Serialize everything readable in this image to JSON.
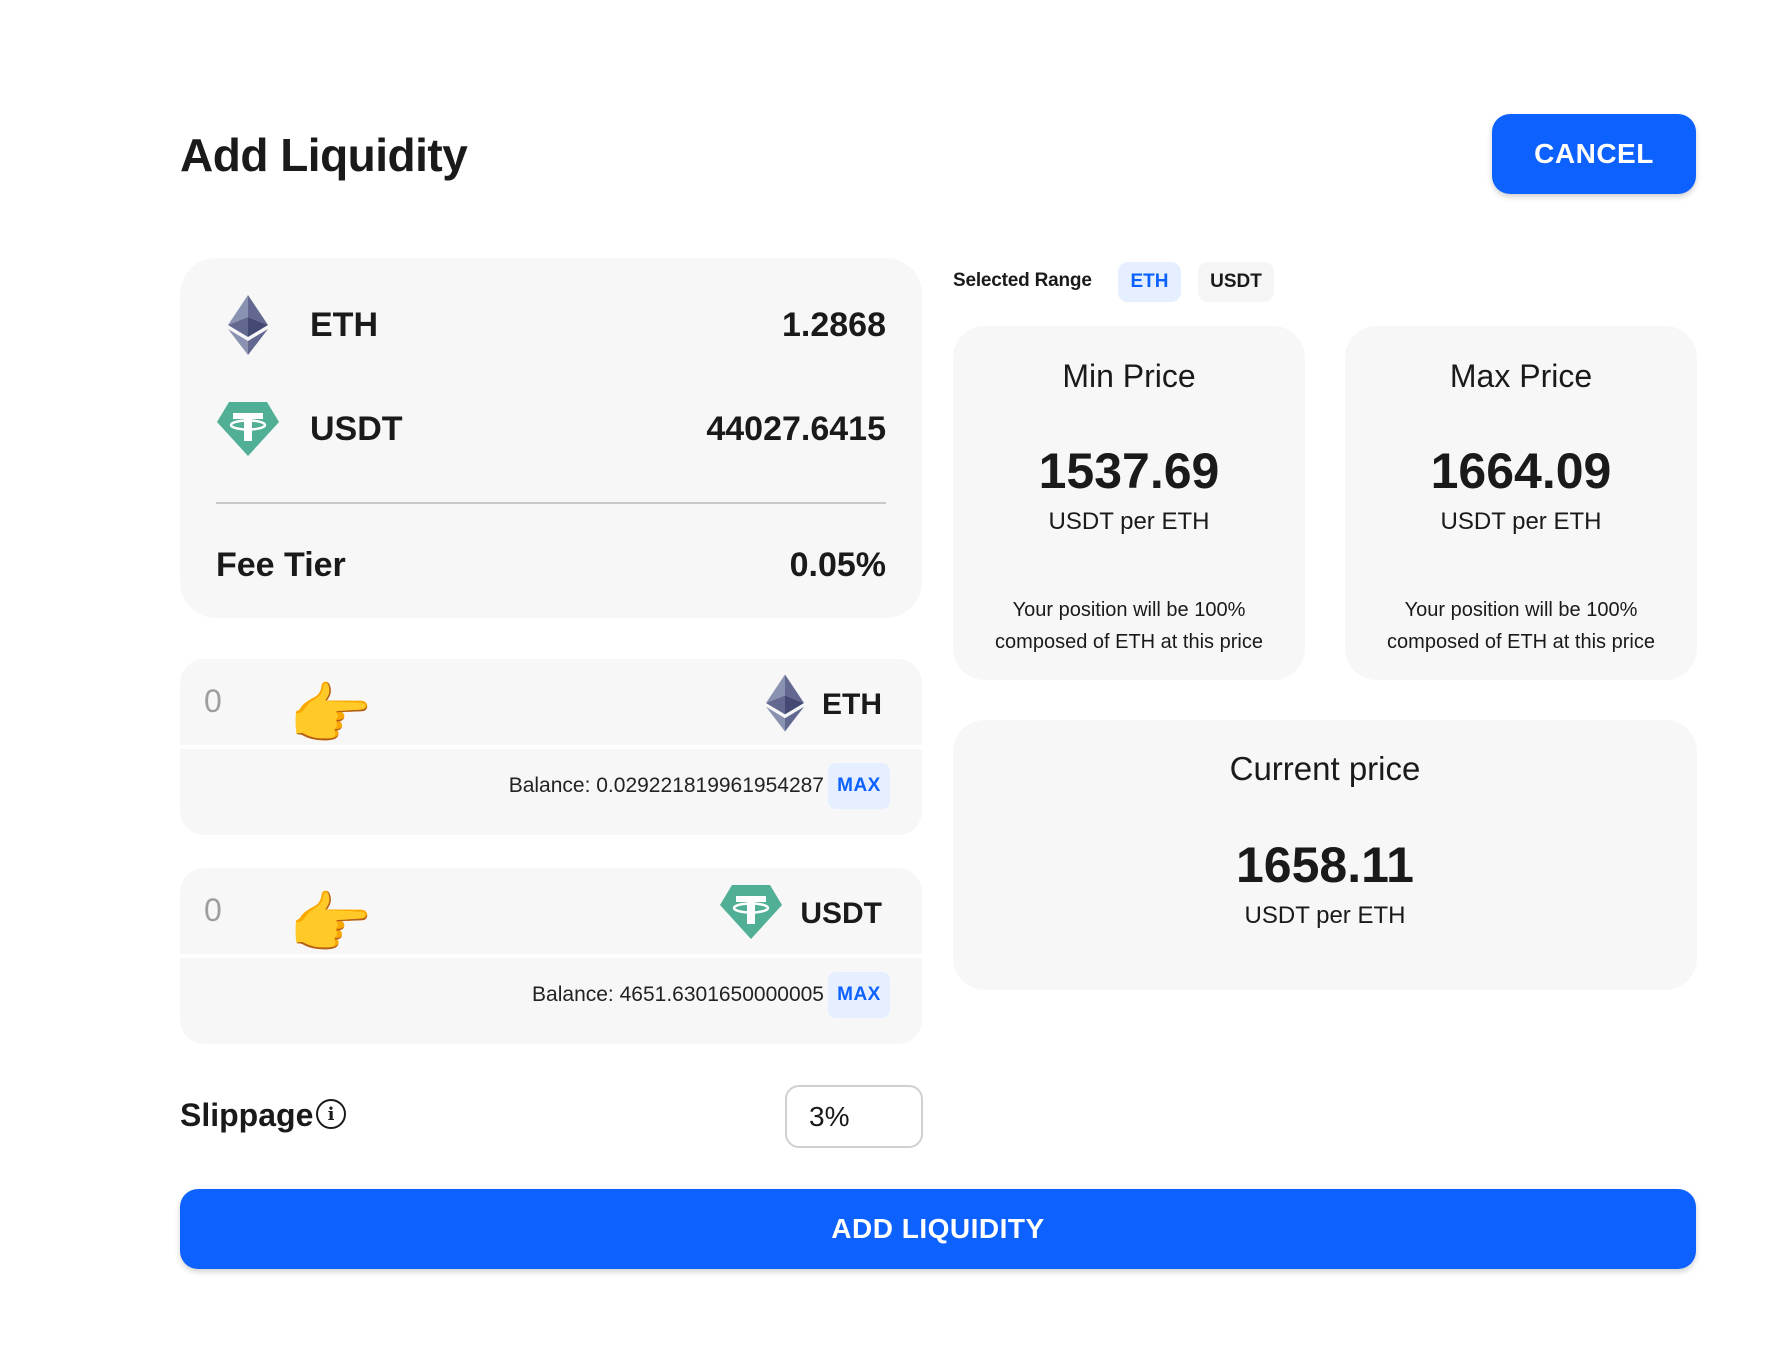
{
  "header": {
    "title": "Add Liquidity",
    "cancel_label": "CANCEL"
  },
  "summary": {
    "tokens": [
      {
        "symbol": "ETH",
        "amount": "1.2868",
        "icon": "ethereum-icon"
      },
      {
        "symbol": "USDT",
        "amount": "44027.6415",
        "icon": "tether-icon"
      }
    ],
    "fee_label": "Fee Tier",
    "fee_value": "0.05%"
  },
  "deposits": [
    {
      "symbol": "ETH",
      "amount_value": "0",
      "balance_text": "Balance: 0.029221819961954287",
      "max_label": "MAX",
      "hand": "👉",
      "icon": "ethereum-icon"
    },
    {
      "symbol": "USDT",
      "amount_value": "0",
      "balance_text": "Balance: 4651.6301650000005",
      "max_label": "MAX",
      "hand": "👉",
      "icon": "tether-icon"
    }
  ],
  "slippage": {
    "label": "Slippage",
    "info": "i",
    "value": "3%"
  },
  "range": {
    "label": "Selected Range",
    "tabs": [
      {
        "label": "ETH",
        "active": true
      },
      {
        "label": "USDT",
        "active": false
      }
    ]
  },
  "min_price": {
    "heading": "Min Price",
    "value": "1537.69",
    "unit": "USDT per ETH",
    "note_line1": "Your position will be 100%",
    "note_line2": "composed of ETH at this price"
  },
  "max_price": {
    "heading": "Max Price",
    "value": "1664.09",
    "unit": "USDT per ETH",
    "note_line1": "Your position will be 100%",
    "note_line2": "composed of ETH at this price"
  },
  "current_price": {
    "heading": "Current price",
    "value": "1658.11",
    "unit": "USDT per ETH"
  },
  "add_label": "ADD LIQUIDITY",
  "colors": {
    "accent": "#0d62ff",
    "accent_light": "#e5efff",
    "card_bg": "#f7f7f7",
    "tether_green": "#50af95"
  }
}
